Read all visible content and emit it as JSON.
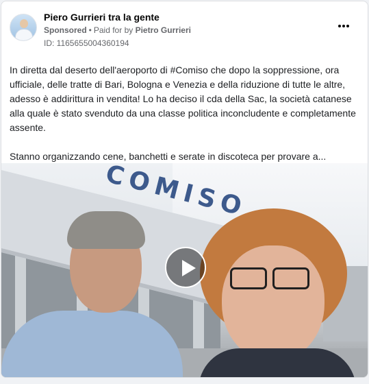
{
  "post": {
    "page_name": "Piero Gurrieri tra la gente",
    "sponsored_label": "Sponsored",
    "separator": "•",
    "paid_for_label": "Paid for by",
    "payer": "Pietro Gurrieri",
    "ad_id": "ID: 1165655004360194",
    "paragraph1": "In diretta dal deserto dell'aeroporto di #Comiso che dopo la soppressione, ora ufficiale, delle tratte di Bari, Bologna e Venezia e della riduzione di tutte le altre, adesso è addirittura in vendita! Lo ha deciso il cda della Sac, la società catanese alla quale è stato svenduto da una classe politica inconcludente e completamente assente.",
    "paragraph2": "Stanno organizzando cene, banchetti e serate in discoteca per provare a..."
  },
  "media": {
    "sign_text": "COMISO",
    "type": "video"
  },
  "icons": {
    "avatar": "profile-photo",
    "more": "more-horizontal-icon",
    "play": "play-icon"
  }
}
